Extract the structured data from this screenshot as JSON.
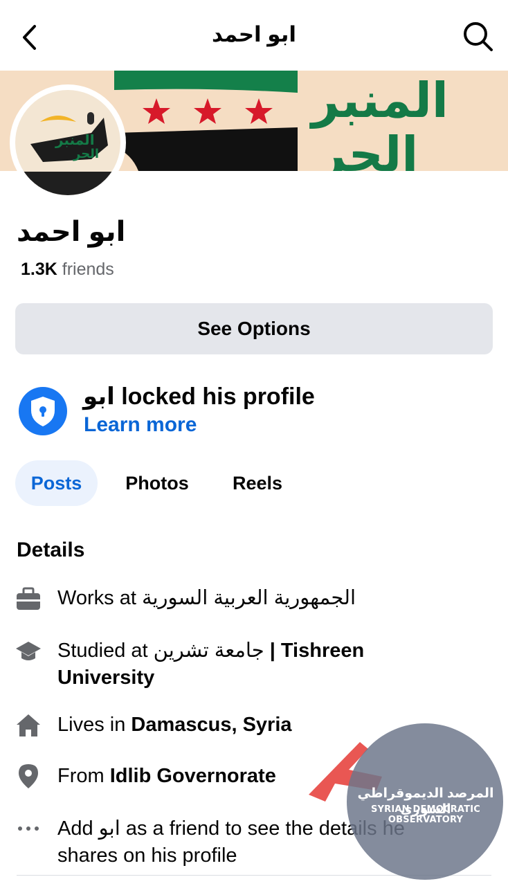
{
  "header": {
    "title": "ابو احمد"
  },
  "cover": {
    "banner_text_1": "المنبر",
    "banner_text_2": "الحر"
  },
  "avatar": {
    "logo_text_1": "المنبر",
    "logo_text_2": "الحر"
  },
  "profile": {
    "name": "ابو احمد",
    "friends_count": "1.3K",
    "friends_label": "friends"
  },
  "actions": {
    "see_options": "See Options"
  },
  "lock_notice": {
    "title": "ابو locked his profile",
    "learn_more": "Learn more"
  },
  "tabs": [
    {
      "label": "Posts"
    },
    {
      "label": "Photos"
    },
    {
      "label": "Reels"
    }
  ],
  "details": {
    "heading": "Details",
    "works": {
      "prefix": "Works at ",
      "value": "الجمهورية العربية السورية"
    },
    "studied": {
      "prefix": "Studied at ",
      "value_ar": "جامعة تشرين",
      "value_en": " | Tishreen",
      "value_en_2": "University"
    },
    "lives": {
      "prefix": "Lives in ",
      "value": "Damascus, Syria"
    },
    "from": {
      "prefix": "From ",
      "value": "Idlib Governorate"
    },
    "add_friend": "Add ابو as a friend to see the details he shares on his profile"
  },
  "watermark": {
    "arabic": "المرصد الديموقراطي السوري",
    "english": "SYRIAN DEMOCRATIC OBSERVATORY"
  },
  "colors": {
    "accent": "#0a66d6",
    "button_bg": "#e4e6eb",
    "active_tab_bg": "#ebf2fd",
    "secondary_text": "#65676b"
  }
}
